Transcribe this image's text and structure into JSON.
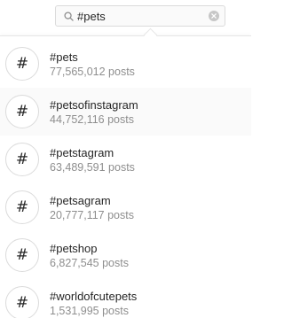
{
  "search": {
    "value": "#pets"
  },
  "icons": {
    "search": "search-icon",
    "clear": "clear-icon",
    "hashtag": "hashtag-icon"
  },
  "results": [
    {
      "hashtag_symbol": "#",
      "name": "#pets",
      "count": "77,565,012 posts"
    },
    {
      "hashtag_symbol": "#",
      "name": "#petsofinstagram",
      "count": "44,752,116 posts"
    },
    {
      "hashtag_symbol": "#",
      "name": "#petstagram",
      "count": "63,489,591 posts"
    },
    {
      "hashtag_symbol": "#",
      "name": "#petsagram",
      "count": "20,777,117 posts"
    },
    {
      "hashtag_symbol": "#",
      "name": "#petshop",
      "count": "6,827,545 posts"
    },
    {
      "hashtag_symbol": "#",
      "name": "#worldofcutepets",
      "count": "1,531,995 posts"
    }
  ]
}
